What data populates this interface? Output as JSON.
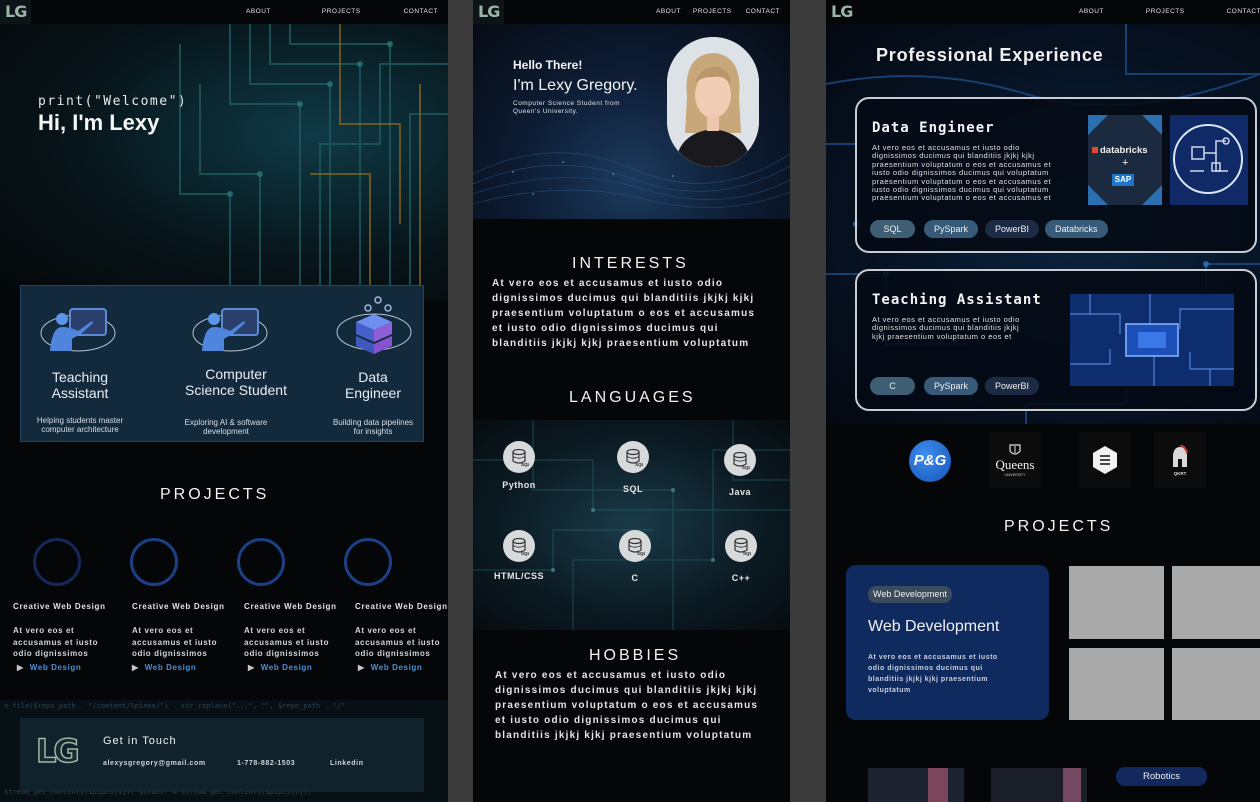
{
  "nav": {
    "logo": "LG",
    "about": "ABOUT",
    "projects": "PROJECTS",
    "contact": "CONTACT"
  },
  "home": {
    "print_line": "print(\"Welcome\")",
    "greeting": "Hi, I'm Lexy",
    "roles": [
      {
        "title_1": "Teaching",
        "title_2": "Assistant",
        "desc_1": "Helping students master",
        "desc_2": "computer architecture"
      },
      {
        "title_1": "Computer",
        "title_2": "Science Student",
        "desc_1": "Exploring AI & software",
        "desc_2": "development"
      },
      {
        "title_1": "Data",
        "title_2": "Engineer",
        "desc_1": "Building data pipelines",
        "desc_2": "for insights"
      }
    ],
    "projects_heading": "PROJECTS",
    "project_cards": [
      {
        "title": "Creative Web Design",
        "l1": "At vero eos et",
        "l2": "accusamus et iusto",
        "l3": "odio dignissimos",
        "link": "Web Design"
      },
      {
        "title": "Creative Web Design",
        "l1": "At vero eos et",
        "l2": "accusamus et iusto",
        "l3": "odio dignissimos",
        "link": "Web Design"
      },
      {
        "title": "Creative Web Design",
        "l1": "At vero eos et",
        "l2": "accusamus et iusto",
        "l3": "odio dignissimos",
        "link": "Web Design"
      },
      {
        "title": "Creative Web Design",
        "l1": "At vero eos et",
        "l2": "accusamus et iusto",
        "l3": "odio dignissimos",
        "link": "Web Design"
      }
    ],
    "footer": {
      "heading": "Get in Touch",
      "email": "alexysgregory@gmail.com",
      "phone": "1-778-882-1503",
      "linkedin": "Linkedin",
      "code_1": "= file($repo_path . \"/content/Spines/\") . str_replace(\"...\", \"\", $repo_path . \"/\"",
      "code_2": "stream_get_contents($pipes[1]); $stderr = stream_get_contents($pipes[2]);"
    }
  },
  "about": {
    "hello": "Hello There!",
    "name": "I'm Lexy Gregory.",
    "sub_1": "Computer Science Student from",
    "sub_2": "Queen's University.",
    "interests_heading": "INTERESTS",
    "interests_lines": [
      "At vero eos et accusamus et iusto odio",
      "dignissimos ducimus qui blanditiis  jkjkj kjkj",
      "praesentium voluptatum o eos et accusamus",
      "et iusto odio dignissimos ducimus qui",
      "blanditiis  jkjkj kjkj praesentium voluptatum"
    ],
    "languages_heading": "LANGUAGES",
    "languages": [
      "Python",
      "SQL",
      "Java",
      "HTML/CSS",
      "C",
      "C++"
    ],
    "db_icon_label": "SQL",
    "hobbies_heading": "HOBBIES",
    "hobbies_lines": [
      "At vero eos et accusamus et iusto odio",
      "dignissimos ducimus qui blanditiis  jkjkj kjkj",
      "praesentium voluptatum o eos et accusamus",
      "et iusto odio dignissimos ducimus qui",
      "blanditiis  jkjkj kjkj praesentium voluptatum"
    ]
  },
  "experience": {
    "heading": "Professional Experience",
    "cards": [
      {
        "title": "Data Engineer",
        "lines": [
          "At vero eos et accusamus et iusto odio",
          "dignissimos ducimus qui blanditiis  jkjkj kjkj",
          "praesentium voluptatum o eos et accusamus et",
          "iusto odio dignissimos ducimus qui voluptatum",
          "praesentium voluptatum o eos et accusamus et",
          "iusto odio dignissimos ducimus qui voluptatum",
          "praesentium voluptatum o eos et accusamus et"
        ],
        "skills": [
          "SQL",
          "PySpark",
          "PowerBI",
          "Databricks"
        ],
        "logo_1": "databricks",
        "logo_2": "SAP"
      },
      {
        "title": "Teaching Assistant",
        "lines": [
          "At vero eos et accusamus et iusto odio",
          "dignissimos ducimus qui blanditiis  jkjkj",
          "kjkj praesentium voluptatum o eos et"
        ],
        "skills": [
          "C",
          "PySpark",
          "PowerBI"
        ]
      }
    ],
    "brands": {
      "pg": "P&G",
      "queens": "Queens",
      "queens_sub": "UNIVERSITY",
      "qkrt": "QKRT"
    },
    "projects_heading": "PROJECTS",
    "project": {
      "tag": "Web Development",
      "title": "Web Development",
      "lines": [
        "At vero eos et accusamus et iusto",
        "odio dignissimos ducimus qui",
        "blanditiis  jkjkj kjkj praesentium",
        "voluptatum"
      ]
    },
    "robotics_tag": "Robotics"
  }
}
